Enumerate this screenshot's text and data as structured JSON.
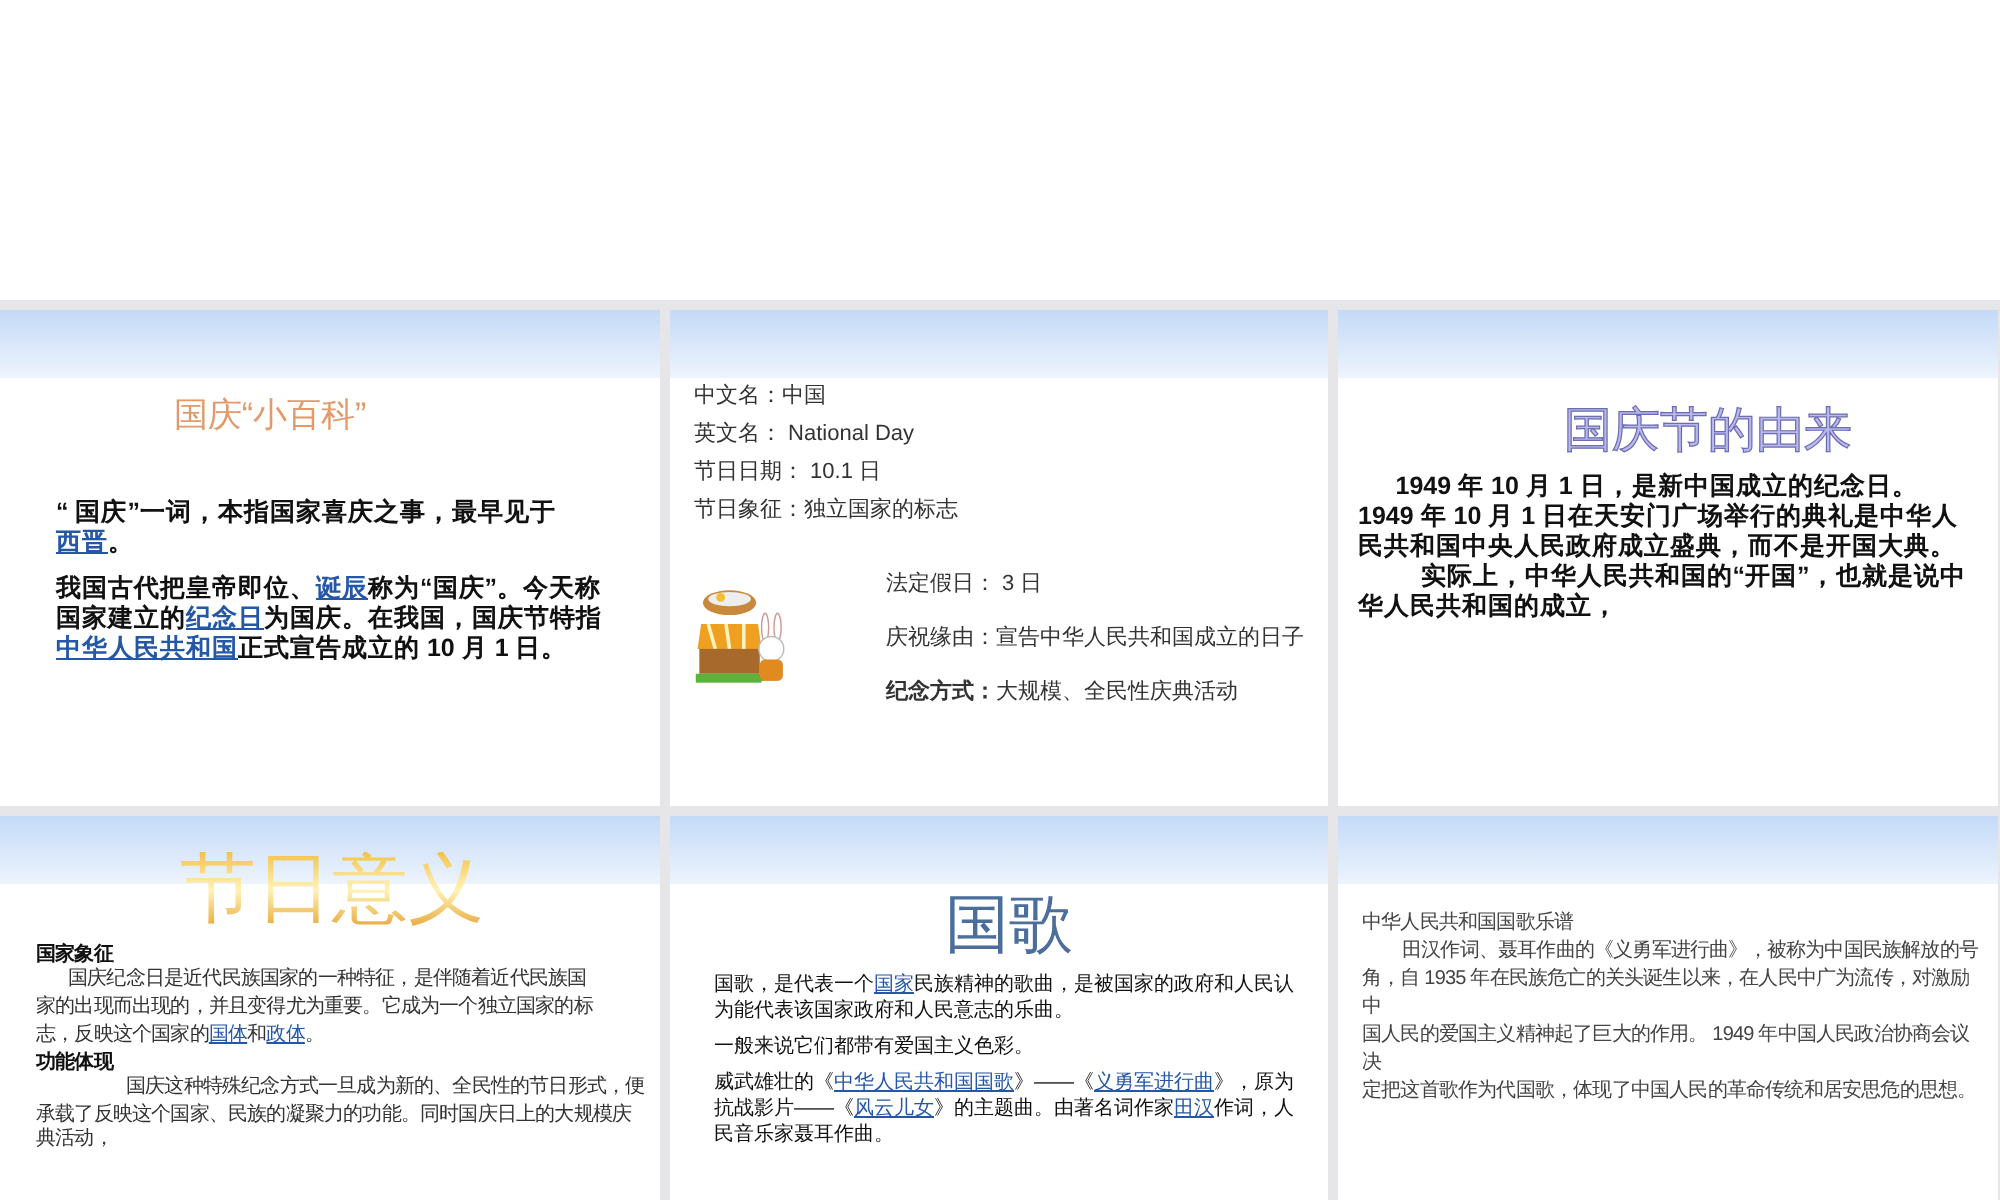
{
  "slides": [
    {
      "kind": "encyclopedia",
      "title": "国庆“小百科”",
      "paragraphs": [
        [
          {
            "text": "“ 国庆”一词，本指国家喜庆之事，最早见于",
            "link": false
          },
          {
            "text": "西晋",
            "link": true
          },
          {
            "text": "。",
            "link": false
          }
        ],
        [
          {
            "text": "我国古代把皇帝即位、",
            "link": false
          },
          {
            "text": "诞辰",
            "link": true
          },
          {
            "text": "称为“国庆”。今天称国家建立的",
            "link": false
          },
          {
            "text": "纪念日",
            "link": true
          },
          {
            "text": "为国庆。在我国，国庆节特指",
            "link": false
          },
          {
            "text": "中华人民共和国",
            "link": true
          },
          {
            "text": "正式宣告成立的 10 月 1 日。",
            "link": false
          }
        ]
      ]
    },
    {
      "kind": "facts",
      "facts": [
        "中文名：中国",
        "英文名： National Day",
        "节日日期： 10.1 日",
        "节日象征：独立国家的标志"
      ],
      "picture": {
        "kind": "clipart"
      },
      "details": [
        "法定假日： 3 日",
        "庆祝缘由：宣告中华人民共和国成立的日子",
        "**纪念方式：**大规模、全民性庆典活动"
      ]
    },
    {
      "kind": "origin",
      "title": "国庆节的由来",
      "paragraphs": [
        [
          {
            "text": "1949 年 10 月 1 日，是新中国成立的纪念日。 1949 年 10 月 1 日在天安门广场举行的典礼是中华人民共和国中央人民政府成立盛典，而不是开国大典。",
            "link": false
          }
        ],
        [
          {
            "text": "实际上，中华人民共和国的“开国”，也就是说中华人民共和国的成立，",
            "link": false
          }
        ]
      ]
    },
    {
      "kind": "meaning",
      "title": "节日意义",
      "sections": [
        {
          "heading": "国家象征",
          "lines": [
            [
              {
                "text": "国庆纪念日是近代民族国家的一种特征，是伴随着近代民族国",
                "link": false
              }
            ],
            [
              {
                "text": "家的出现而出现的，并且变得尤为重要。它成为一个独立国家的标",
                "link": false
              }
            ],
            [
              {
                "text": "志，反映这个国家的",
                "link": false
              },
              {
                "text": "国体",
                "link": true
              },
              {
                "text": "和",
                "link": false
              },
              {
                "text": "政体",
                "link": true
              },
              {
                "text": "。",
                "link": false
              }
            ]
          ]
        },
        {
          "heading": "功能体现",
          "lines": [
            [
              {
                "text": "国庆这种特殊纪念方式一旦成为新的、全民性的节日形式，便",
                "link": false
              }
            ],
            [
              {
                "text": "承载了反映这个国家、民族的凝聚力的功能。同时国庆日上的大规模庆典活动，",
                "link": false
              }
            ]
          ]
        }
      ]
    },
    {
      "kind": "anthem",
      "title": "国歌",
      "paragraphs": [
        [
          {
            "text": "国歌，是代表一个",
            "link": false
          },
          {
            "text": "国家",
            "link": true
          },
          {
            "text": "民族精神的歌曲，是被国家的政府和人民认为能代表该国家政府和人民意志的乐曲。",
            "link": false
          }
        ],
        [
          {
            "text": "一般来说它们都带有爱国主义色彩。",
            "link": false
          }
        ],
        [
          {
            "text": "威武雄壮的《",
            "link": false
          },
          {
            "text": "中华人民共和国国歌",
            "link": true
          },
          {
            "text": "》——《",
            "link": false
          },
          {
            "text": "义勇军进行曲",
            "link": true
          },
          {
            "text": "》，原为抗战影片——《",
            "link": false
          },
          {
            "text": "风云儿女",
            "link": true
          },
          {
            "text": "》的主题曲。由著名词作家",
            "link": false
          },
          {
            "text": "田汉",
            "link": true
          },
          {
            "text": "作词，人民音乐家聂耳作曲。",
            "link": false
          }
        ]
      ]
    },
    {
      "kind": "score",
      "lines": [
        "中华人民共和国国歌乐谱",
        "田汉作词、聂耳作曲的《义勇军进行曲》，被称为中国民族解放的号",
        "角，自 1935 年在民族危亡的关头诞生以来，在人民中广为流传，对激励",
        "中",
        "国人民的爱国主义精神起了巨大的作用。 1949 年中国人民政治协商会议",
        "决",
        "定把这首歌作为代国歌，体现了中国人民的革命传统和居安思危的思想。"
      ]
    }
  ]
}
